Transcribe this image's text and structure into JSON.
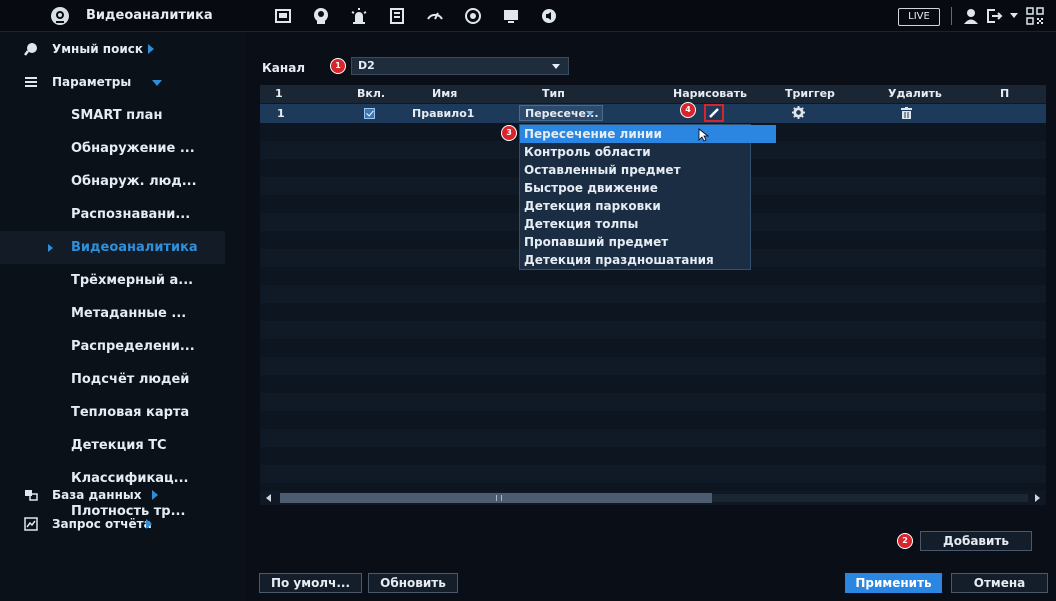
{
  "app": {
    "title": "Видеоаналитика"
  },
  "topbar": {
    "icons": [
      "camera-icon",
      "face-icon",
      "alarm-icon",
      "storage-icon",
      "network-icon",
      "record-icon",
      "display-icon",
      "audio-icon"
    ],
    "live_label": "LIVE",
    "user_icon": "user-icon",
    "logout_icon": "logout-icon",
    "qr_icon": "qr-icon"
  },
  "sidebar": {
    "smart_search": "Умный поиск",
    "params": "Параметры",
    "items": [
      {
        "label": "SMART план"
      },
      {
        "label": "Обнаружение ..."
      },
      {
        "label": "Обнаруж. люд..."
      },
      {
        "label": "Распознавани..."
      },
      {
        "label": "Видеоаналитика",
        "active": true
      },
      {
        "label": "Трёхмерный а..."
      },
      {
        "label": "Метаданные ..."
      },
      {
        "label": "Распределени..."
      },
      {
        "label": "Подсчёт людей"
      },
      {
        "label": "Тепловая карта"
      },
      {
        "label": "Детекция ТС"
      },
      {
        "label": "Классификац..."
      },
      {
        "label": "Плотность тр..."
      }
    ],
    "database": "База данных",
    "report": "Запрос отчёта"
  },
  "main": {
    "channel_label": "Канал",
    "channel_value": "D2",
    "columns": [
      "1",
      "Вкл.",
      "Имя",
      "Тип",
      "Нарисовать",
      "Триггер",
      "Удалить",
      "П"
    ],
    "row": {
      "index": "1",
      "enabled": true,
      "name": "Правило1",
      "type": "Пересече..."
    },
    "type_options": [
      "Пересечение линии",
      "Контроль области",
      "Оставленный предмет",
      "Быстрое движение",
      "Детекция парковки",
      "Детекция толпы",
      "Пропавший предмет",
      "Детекция праздношатания"
    ],
    "badges": [
      "1",
      "2",
      "3",
      "4"
    ],
    "buttons": {
      "add": "Добавить",
      "default": "По умолч...",
      "refresh": "Обновить",
      "apply": "Применить",
      "cancel": "Отмена"
    }
  },
  "colors": {
    "accent": "#2a86e0",
    "badge": "#d8242c",
    "background": "#0a0f17"
  }
}
